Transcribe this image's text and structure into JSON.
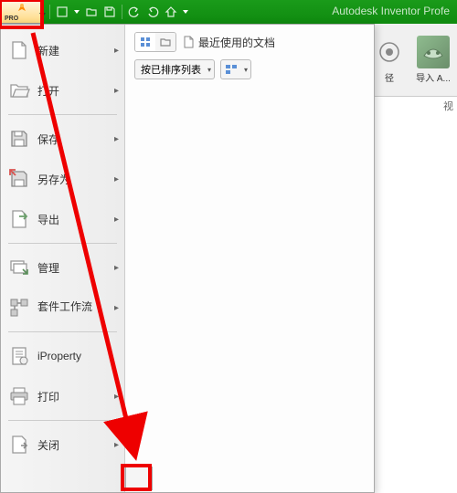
{
  "titlebar": {
    "title": "Autodesk Inventor Profe",
    "pro_label": "PRO"
  },
  "menu": {
    "items": [
      {
        "label": "新建",
        "icon": "new",
        "arrow": true
      },
      {
        "label": "打开",
        "icon": "open",
        "arrow": true
      },
      {
        "label": "保存",
        "icon": "save",
        "arrow": true
      },
      {
        "label": "另存为",
        "icon": "saveas",
        "arrow": true
      },
      {
        "label": "导出",
        "icon": "export",
        "arrow": true
      },
      {
        "label": "管理",
        "icon": "manage",
        "arrow": true
      },
      {
        "label": "套件工作流",
        "icon": "suite",
        "arrow": true
      },
      {
        "label": "iProperty",
        "icon": "iprop",
        "arrow": false
      },
      {
        "label": "打印",
        "icon": "print",
        "arrow": true
      },
      {
        "label": "关闭",
        "icon": "close",
        "arrow": true
      }
    ]
  },
  "content": {
    "recent_title": "最近使用的文档",
    "sort_label": "按已排序列表"
  },
  "ribbon": {
    "items": [
      {
        "label": "径",
        "icon": "path"
      },
      {
        "label": "导入 A...",
        "icon": "import"
      }
    ],
    "truncated": "视"
  }
}
